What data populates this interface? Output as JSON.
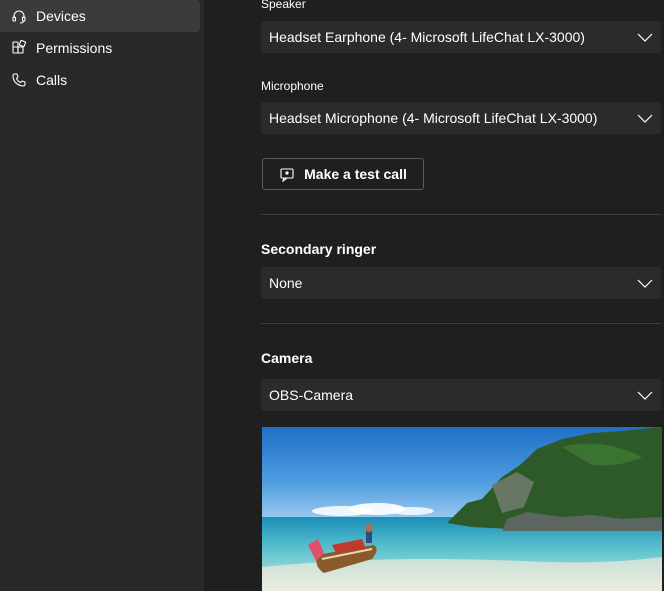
{
  "sidebar": {
    "items": [
      {
        "label": "Devices",
        "icon": "headset-icon",
        "active": true
      },
      {
        "label": "Permissions",
        "icon": "permissions-icon",
        "active": false
      },
      {
        "label": "Calls",
        "icon": "phone-icon",
        "active": false
      }
    ]
  },
  "speaker": {
    "label": "Speaker",
    "value": "Headset Earphone (4- Microsoft LifeChat LX-3000)"
  },
  "microphone": {
    "label": "Microphone",
    "value": "Headset Microphone (4- Microsoft LifeChat LX-3000)"
  },
  "test_call": {
    "label": "Make a test call",
    "icon": "test-call-icon"
  },
  "secondary_ringer": {
    "title": "Secondary ringer",
    "value": "None"
  },
  "camera": {
    "title": "Camera",
    "value": "OBS-Camera",
    "preview": "beach-boat-scene"
  },
  "colors": {
    "sidebar_bg": "#292929",
    "main_bg": "#1f1f1f",
    "select_bg": "#2b2b2b",
    "active_item_bg": "#3b3b3b"
  }
}
